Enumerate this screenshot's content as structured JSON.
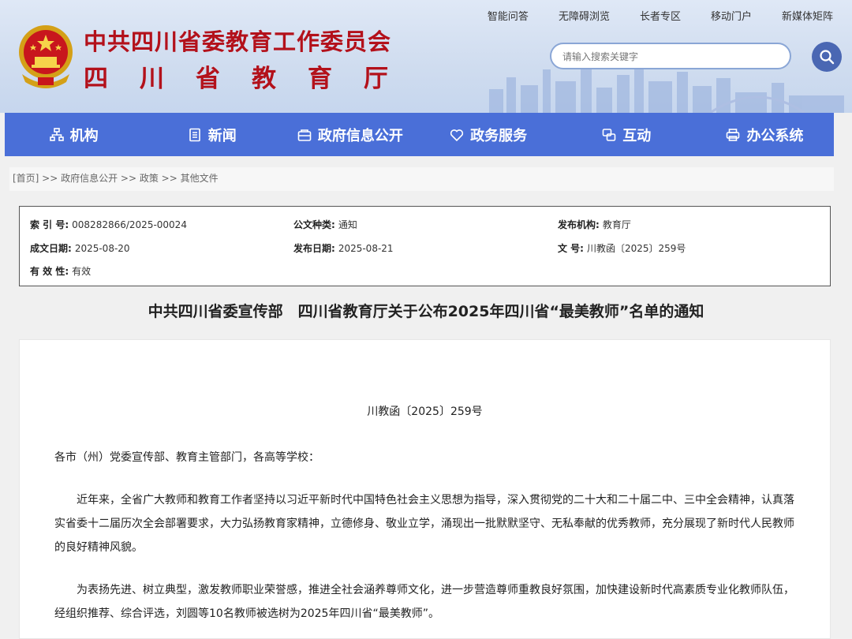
{
  "site": {
    "title": "中共四川省委教育工作委员会",
    "subtitle": "四川省教育厅"
  },
  "top_links": [
    "智能问答",
    "无障碍浏览",
    "长者专区",
    "移动门户",
    "新媒体矩阵"
  ],
  "search": {
    "placeholder": "请输入搜索关键字"
  },
  "nav": [
    {
      "label": "机构",
      "icon": "org-chart-icon"
    },
    {
      "label": "新闻",
      "icon": "news-icon"
    },
    {
      "label": "政府信息公开",
      "icon": "info-open-icon"
    },
    {
      "label": "政务服务",
      "icon": "service-heart-icon"
    },
    {
      "label": "互动",
      "icon": "interaction-icon"
    },
    {
      "label": "办公系统",
      "icon": "office-system-icon"
    }
  ],
  "breadcrumb": "[首页] >> 政府信息公开 >> 政策 >> 其他文件",
  "meta": {
    "index_no": {
      "key": "索 引 号:",
      "value": "008282866/2025-00024"
    },
    "doc_type": {
      "key": "公文种类:",
      "value": "通知"
    },
    "publisher": {
      "key": "发布机构:",
      "value": "教育厅"
    },
    "created": {
      "key": "成文日期:",
      "value": "2025-08-20"
    },
    "published": {
      "key": "发布日期:",
      "value": "2025-08-21"
    },
    "doc_no": {
      "key": "文 号:",
      "value": "川教函〔2025〕259号"
    },
    "validity": {
      "key": "有 效 性:",
      "value": "有效"
    }
  },
  "document": {
    "title": "中共四川省委宣传部　四川省教育厅关于公布2025年四川省“最美教师”名单的通知",
    "number": "川教函〔2025〕259号",
    "addressee": "各市（州）党委宣传部、教育主管部门，各高等学校：",
    "paragraphs": [
      "近年来，全省广大教师和教育工作者坚持以习近平新时代中国特色社会主义思想为指导，深入贯彻党的二十大和二十届二中、三中全会精神，认真落实省委十二届历次全会部署要求，大力弘扬教育家精神，立德修身、敬业立学，涌现出一批默默坚守、无私奉献的优秀教师，充分展现了新时代人民教师的良好精神风貌。",
      "为表扬先进、树立典型，激发教师职业荣誉感，推进全社会涵养尊师文化，进一步营造尊师重教良好氛围，加快建设新时代高素质专业化教师队伍，经组织推荐、综合评选，刘圆等10名教师被选树为2025年四川省“最美教师”。"
    ]
  },
  "colors": {
    "brand_red": "#b3111b",
    "nav_blue": "#4a6fd8",
    "search_blue": "#4a67b3"
  }
}
